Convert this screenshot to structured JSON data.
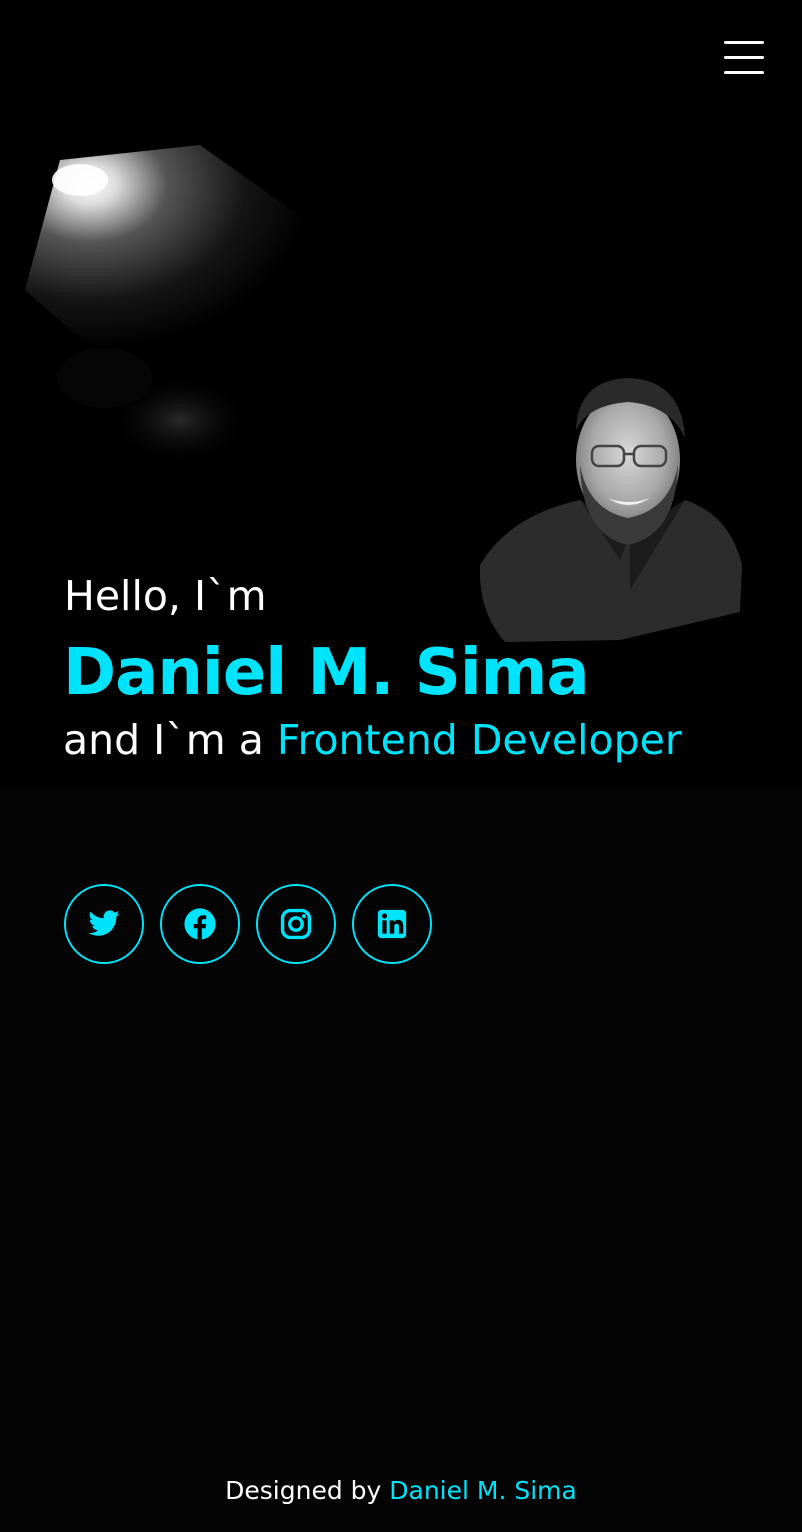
{
  "header": {
    "menu_icon": "hamburger-menu-icon"
  },
  "hero": {
    "greeting": "Hello, I`m",
    "name": "Daniel M. Sima",
    "role_prefix": "and I`m a ",
    "role": "Frontend Developer"
  },
  "socials": [
    {
      "icon": "twitter-icon"
    },
    {
      "icon": "facebook-icon"
    },
    {
      "icon": "instagram-icon"
    },
    {
      "icon": "linkedin-icon"
    }
  ],
  "footer": {
    "prefix": "Designed by ",
    "author": "Daniel M. Sima"
  },
  "colors": {
    "accent": "#00e4fb",
    "background": "#000000",
    "text": "#ffffff"
  }
}
